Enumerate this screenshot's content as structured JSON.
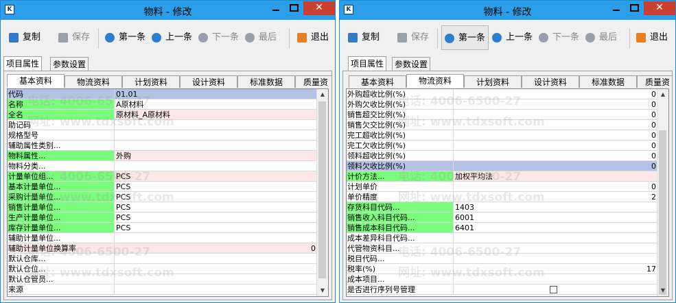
{
  "windows": [
    {
      "title": "物料 - 修改",
      "toolbar": {
        "copy": "复制",
        "save": "保存",
        "first": "第一条",
        "prev": "上一条",
        "next": "下一条",
        "last": "最后",
        "exit": "退出"
      },
      "top_tabs": [
        "项目属性",
        "参数设置"
      ],
      "sub_tabs": [
        "基本资料",
        "物流资料",
        "计划资料",
        "设计资料",
        "标准数据",
        "质量资"
      ],
      "active_sub_tab": "基本资料",
      "rows": [
        {
          "label": "代码",
          "value": "01.01"
        },
        {
          "label": "名称",
          "value": "A原材料"
        },
        {
          "label": "全名",
          "value": "原材料_A原材料"
        },
        {
          "label": "助记码",
          "value": ""
        },
        {
          "label": "规格型号",
          "value": ""
        },
        {
          "label": "辅助属性类别...",
          "value": ""
        },
        {
          "label": "物料属性...",
          "value": "外购"
        },
        {
          "label": "物料分类...",
          "value": ""
        },
        {
          "label": "计量单位组...",
          "value": "PCS"
        },
        {
          "label": "基本计量单位...",
          "value": "PCS"
        },
        {
          "label": "采购计量单位...",
          "value": "PCS"
        },
        {
          "label": "销售计量单位...",
          "value": "PCS"
        },
        {
          "label": "生产计量单位...",
          "value": "PCS"
        },
        {
          "label": "库存计量单位...",
          "value": "PCS"
        },
        {
          "label": "辅助计量单位...",
          "value": ""
        },
        {
          "label": "辅助计量单位换算率",
          "value": "0"
        },
        {
          "label": "默认仓库...",
          "value": ""
        },
        {
          "label": "默认仓位...",
          "value": ""
        },
        {
          "label": "默认仓管员...",
          "value": ""
        },
        {
          "label": "来源",
          "value": ""
        }
      ]
    },
    {
      "title": "物料 - 修改",
      "toolbar": {
        "copy": "复制",
        "save": "保存",
        "first": "第一条",
        "prev": "上一条",
        "next": "下一条",
        "last": "最后",
        "exit": "退出"
      },
      "top_tabs": [
        "项目属性",
        "参数设置"
      ],
      "sub_tabs": [
        "基本资料",
        "物流资料",
        "计划资料",
        "设计资料",
        "标准数据",
        "质量资"
      ],
      "active_sub_tab": "物流资料",
      "rows": [
        {
          "label": "外购超收比例(%)",
          "value": "0"
        },
        {
          "label": "外购欠收比例(%)",
          "value": "0"
        },
        {
          "label": "销售超交比例(%)",
          "value": "0"
        },
        {
          "label": "销售欠交比例(%)",
          "value": "0"
        },
        {
          "label": "完工超收比例(%)",
          "value": "0"
        },
        {
          "label": "完工欠收比例(%)",
          "value": "0"
        },
        {
          "label": "领料超收比例(%)",
          "value": "0"
        },
        {
          "label": "领料欠收比例(%)",
          "value": "0"
        },
        {
          "label": "计价方法...",
          "value": "加权平均法"
        },
        {
          "label": "计划单价",
          "value": "0"
        },
        {
          "label": "单价精度",
          "value": "2"
        },
        {
          "label": "存货科目代码...",
          "value": "1403"
        },
        {
          "label": "销售收入科目代码...",
          "value": "6001"
        },
        {
          "label": "销售成本科目代码...",
          "value": "6401"
        },
        {
          "label": "成本差异科目代码...",
          "value": ""
        },
        {
          "label": "代管物资科目...",
          "value": ""
        },
        {
          "label": "税目代码...",
          "value": ""
        },
        {
          "label": "税率(%)",
          "value": "17"
        },
        {
          "label": "成本项目...",
          "value": ""
        },
        {
          "label": "是否进行序列号管理",
          "value": ""
        }
      ]
    }
  ],
  "watermarks": {
    "phone": "电话: 4006-6500-27",
    "site": "网址: www.tdxsoft.com"
  },
  "colors": {
    "titlebar": "#2a9ee8",
    "required_field": "#7cfc7c",
    "highlight_row": "#fce8e8",
    "selected_row": "#b4c2e6"
  }
}
